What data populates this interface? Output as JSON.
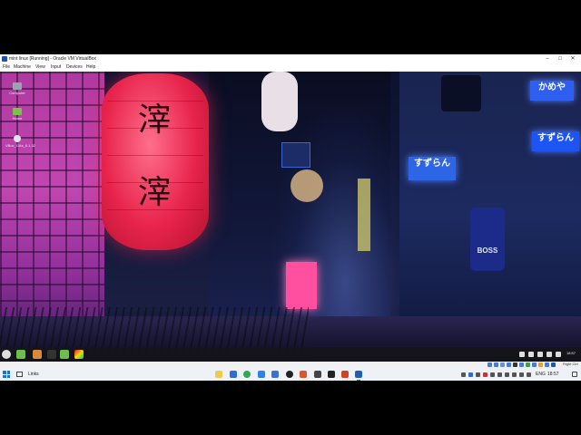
{
  "window": {
    "title": "mint linux [Running] - Oracle VM VirtualBox",
    "controls": {
      "minimize": "–",
      "maximize": "□",
      "close": "✕"
    }
  },
  "menu": [
    "File",
    "Machine",
    "View",
    "Input",
    "Devices",
    "Help"
  ],
  "desktop_icons": [
    {
      "label": "Computer",
      "icon": "computer-icon",
      "color": "#9aa3b0"
    },
    {
      "label": "Home",
      "icon": "folder-icon",
      "color": "#7cbf4a"
    },
    {
      "label": "VBox_GAs_6.1.32",
      "icon": "disc-icon",
      "color": "#dfe3ea"
    }
  ],
  "wallpaper": {
    "lantern_glyphs": [
      "滓",
      "滓"
    ],
    "signs": {
      "blue_1": "かめや",
      "blue_2": "すずらん",
      "blue_3": "すずらん",
      "boss": "BOSS"
    }
  },
  "guest_panel": {
    "apps": [
      "menu-icon",
      "files-icon",
      "terminal-icon",
      "firefox-icon",
      "folder-icon",
      "color-icon"
    ],
    "clock": "18:57"
  },
  "vbox_status": {
    "host_key": "Right Ctrl"
  },
  "taskbar": {
    "search_text": "Links",
    "language": "ENG",
    "time": "18:57",
    "apps": [
      {
        "name": "file-explorer-icon",
        "color": "#f2c94c"
      },
      {
        "name": "mail-icon",
        "color": "#2e6bd6"
      },
      {
        "name": "chrome-icon",
        "color": "#34a853"
      },
      {
        "name": "vscode-icon",
        "color": "#2f80ed"
      },
      {
        "name": "store-icon",
        "color": "#3b6fd1"
      },
      {
        "name": "record-icon",
        "color": "#222222"
      },
      {
        "name": "brave-icon",
        "color": "#e0532f"
      },
      {
        "name": "app-icon",
        "color": "#444444"
      },
      {
        "name": "terminal-icon",
        "color": "#222222"
      },
      {
        "name": "office-icon",
        "color": "#d04423"
      },
      {
        "name": "virtualbox-icon",
        "color": "#1f5fb8"
      }
    ]
  }
}
